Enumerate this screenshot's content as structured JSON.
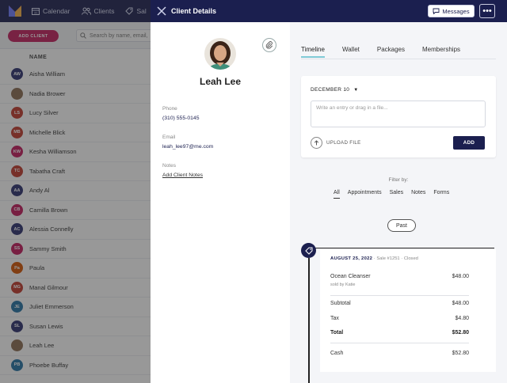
{
  "topnav": {
    "items": [
      {
        "label": "Calendar",
        "icon": "calendar-icon"
      },
      {
        "label": "Clients",
        "icon": "users-icon"
      },
      {
        "label": "Sal",
        "icon": "tag-icon"
      }
    ]
  },
  "toolbar": {
    "add_client_label": "ADD CLIENT",
    "search_placeholder": "Search by name, email,"
  },
  "list": {
    "header": "NAME",
    "clients": [
      {
        "initials": "AW",
        "name": "Aisha William",
        "color": "#2b2f6e"
      },
      {
        "initials": "",
        "name": "Nadia Brower",
        "color": "#8a6b52",
        "photo": true
      },
      {
        "initials": "LS",
        "name": "Lucy Silver",
        "color": "#c0392b"
      },
      {
        "initials": "MB",
        "name": "Michelle Blick",
        "color": "#c0392b"
      },
      {
        "initials": "KW",
        "name": "Kesha Williamson",
        "color": "#c2185b"
      },
      {
        "initials": "TC",
        "name": "Tabatha Craft",
        "color": "#c0392b"
      },
      {
        "initials": "AA",
        "name": "Andy Al",
        "color": "#2b2f6e"
      },
      {
        "initials": "CB",
        "name": "Camilla Brown",
        "color": "#c2185b"
      },
      {
        "initials": "AC",
        "name": "Alessia Connelly",
        "color": "#2b2f6e"
      },
      {
        "initials": "SS",
        "name": "Sammy Smith",
        "color": "#c2185b"
      },
      {
        "initials": "Pa",
        "name": "Paula",
        "color": "#d35400"
      },
      {
        "initials": "MG",
        "name": "Manal Gilmour",
        "color": "#c0392b"
      },
      {
        "initials": "JE",
        "name": "Juliet Emmerson",
        "color": "#2471a3"
      },
      {
        "initials": "SL",
        "name": "Susan Lewis",
        "color": "#2b2f6e"
      },
      {
        "initials": "",
        "name": "Leah Lee",
        "color": "#8a6b52",
        "photo": true
      },
      {
        "initials": "PB",
        "name": "Phoebe Buffay",
        "color": "#2471a3"
      }
    ]
  },
  "panel": {
    "title": "Client Details",
    "messages_label": "Messages",
    "more_label": "•••",
    "client": {
      "name": "Leah Lee",
      "phone_label": "Phone",
      "phone": "(310) 555-0145",
      "email_label": "Email",
      "email": "leah_lee97@me.com",
      "notes_label": "Notes",
      "add_notes": "Add Client Notes"
    },
    "tabs": [
      "Timeline",
      "Wallet",
      "Packages",
      "Memberships"
    ],
    "active_tab": "Timeline",
    "entry": {
      "date": "DECEMBER 10",
      "placeholder": "Write an entry or drag in a file...",
      "upload_label": "UPLOAD FILE",
      "add_label": "ADD"
    },
    "filter": {
      "label": "Filter by:",
      "options": [
        "All",
        "Appointments",
        "Sales",
        "Notes",
        "Forms"
      ],
      "active": "All"
    },
    "past_label": "Past",
    "sale": {
      "date": "AUGUST 25, 2022",
      "sale_no": "Sale #1251",
      "status": "Closed",
      "item": "Ocean Cleanser",
      "item_price": "$48.00",
      "sold_by": "sold by Katie",
      "subtotal_label": "Subtotal",
      "subtotal": "$48.00",
      "tax_label": "Tax",
      "tax": "$4.80",
      "total_label": "Total",
      "total": "$52.80",
      "cash_label": "Cash",
      "cash": "$52.80"
    }
  },
  "colors": {
    "navy": "#1b1f4f",
    "brand_pink": "#c21d5d",
    "tab_accent": "#7fcad6"
  }
}
